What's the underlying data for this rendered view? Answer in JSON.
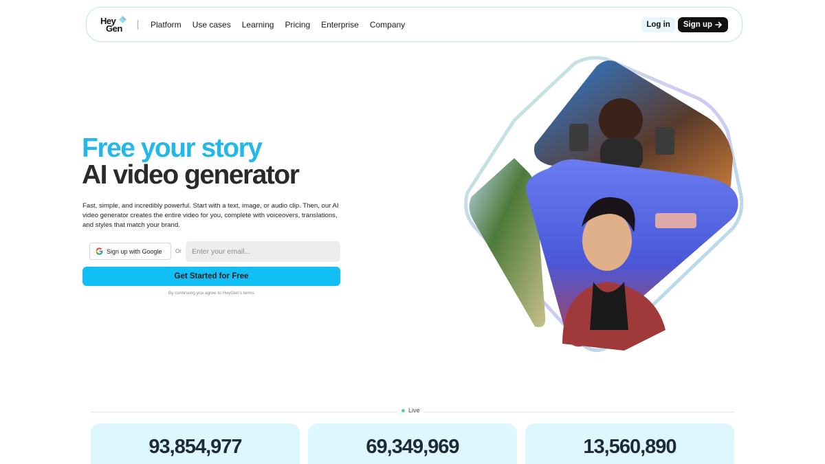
{
  "brand": {
    "line1": "Hey",
    "line2": "Gen",
    "accent": "#22b8ea"
  },
  "nav": {
    "links": [
      "Platform",
      "Use cases",
      "Learning",
      "Pricing",
      "Enterprise",
      "Company"
    ],
    "login_label": "Log in",
    "signup_label": "Sign up",
    "signup_icon": "arrow-right-icon"
  },
  "hero": {
    "title_line1": "Free your story",
    "title_line2": "AI video generator",
    "description": "Fast, simple, and incredibly powerful. Start with a text, image, or audio clip. Then, our AI video generator creates the entire video for you, complete with voiceovers, translations, and styles that match your brand.",
    "google_button_label": "Sign up with Google",
    "or_label": "Or",
    "email_placeholder": "Enter your email...",
    "cta_label": "Get Started for Free",
    "terms": "By continuing you agree to HeyGen's terms",
    "cta_color": "#12bff5"
  },
  "live": {
    "label": "Live",
    "dot_color": "#5fd38a"
  },
  "stats": [
    "93,854,977",
    "69,349,969",
    "13,560,890"
  ]
}
